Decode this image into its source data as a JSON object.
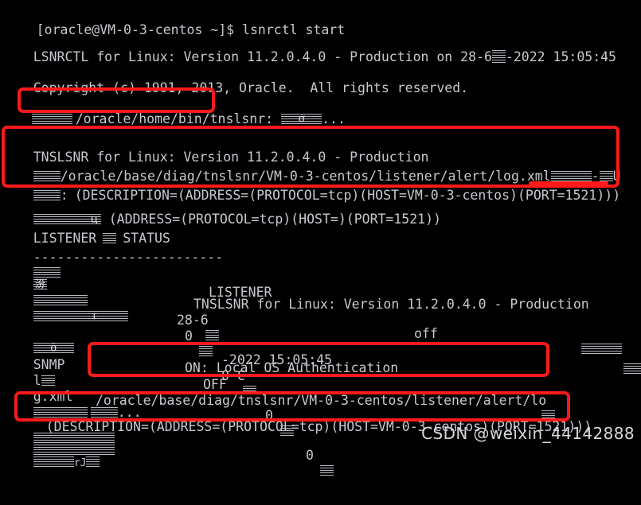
{
  "terminal": {
    "background_color": "#000000",
    "text_color": "#c8c8d0",
    "annotation_color": "#ff1a1a",
    "prompt_line": "[oracle@VM-0-3-centos ~]$ lsnrctl start",
    "lines": {
      "l1": "[oracle@VM-0-3-centos ~]$ lsnrctl start",
      "l2_a": "LSNRCTL for Linux: Version 11.2.0.4.0 - Production on 28-6",
      "l2_b": "-2022 15:05:45",
      "l3": "Copyright (c) 1991, 2013, Oracle.  All rights reserved.",
      "l4_path": "/oracle/home/bin/tnslsnr:",
      "l4_tail": "...",
      "l5": "TNSLSNR for Linux: Version 11.2.0.4.0 - Production",
      "l6_path": "/oracle/base/diag/tnslsnr/VM-0-3-centos/listener/alert/log.xml",
      "l6_tail": "-",
      "l6_tail2": "U",
      "l7_colon": ":",
      "l7_desc": "(DESCRIPTION=(ADDRESS=(PROTOCOL=tcp)(HOST=VM-0-3-centos)(PORT=1521)))",
      "l8": "(ADDRESS=(PROTOCOL=tcp)(HOST=)(PORT=1521))",
      "l9_a": "LISTENER",
      "l9_b": "STATUS",
      "l10_sep": "------------------------",
      "l11_val": "LISTENER",
      "l12_val": "TNSLSNR for Linux: Version 11.2.0.4.0 - Production",
      "l13_val_a": "28-6",
      "l13_val_b": "-2022 15:05:45",
      "l14_val_a": "0",
      "l14_val_b": "0 C",
      "l14_val_c": "0",
      "l14_val_d": "0",
      "l15_val": "off",
      "l16_val": "ON: Local OS Authentication",
      "l17_label": "SNMP",
      "l17_val": "OFF",
      "l18_label": "l",
      "l18_path": "/oracle/base/diag/tnslsnr/VM-0-3-centos/listener/alert/lo",
      "l19_label": "g.xml",
      "l20_tail": "...",
      "l21_desc": "(DESCRIPTION=(ADDRESS=(PROTOCOL=tcp)(HOST=VM-0-3-centos)(PORT=1521)))",
      "l24_tail": "rJ"
    },
    "annotations": {
      "box1_label": "tnslsnr-binary-path-box",
      "box2_label": "listener-startup-details-box",
      "box3_label": "listener-log-path-box",
      "box4_label": "listening-endpoint-box",
      "underline_label": "port-1521-underline"
    }
  },
  "watermark": {
    "text": "CSDN @weixin_44142888"
  }
}
